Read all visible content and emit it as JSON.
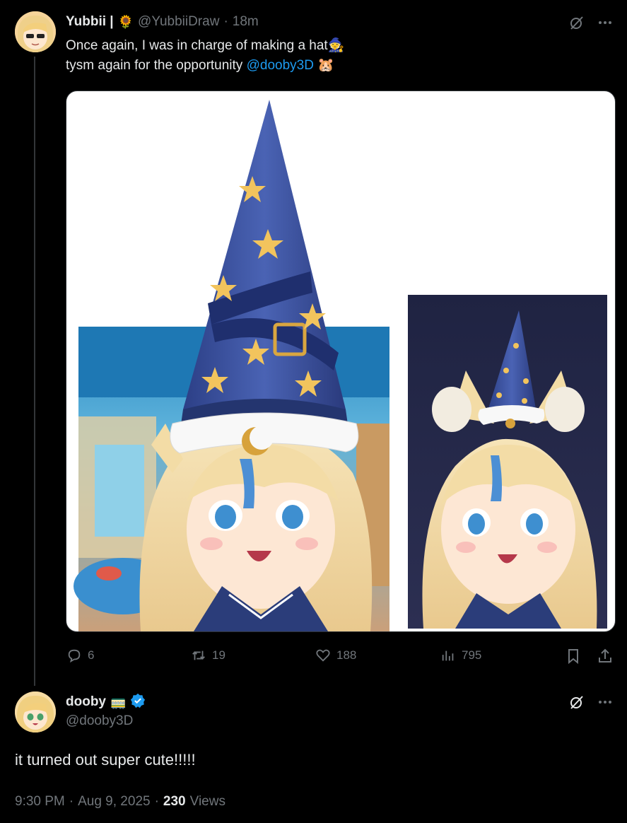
{
  "parent_tweet": {
    "display_name": "Yubbii |",
    "name_emoji": "🌻",
    "handle": "@YubbiiDraw",
    "separator": "·",
    "time": "18m",
    "line1": "Once again, I was in charge of making a hat",
    "line1_emoji": "🧙",
    "line2_prefix": "tysm again for the opportunity ",
    "mention": "@dooby3D",
    "line2_emoji": "🐹",
    "stats": {
      "replies": "6",
      "retweets": "19",
      "likes": "188",
      "views": "795"
    }
  },
  "reply_tweet": {
    "display_name": "dooby",
    "name_emoji": "🚃",
    "handle": "@dooby3D",
    "text": "it turned out super cute!!!!!",
    "time": "9:30 PM",
    "date": "Aug 9, 2025",
    "dot": "·",
    "views_count": "230",
    "views_label": "Views"
  },
  "icons": {
    "grok": "grok-icon",
    "more": "more-icon",
    "reply": "reply-icon",
    "retweet": "retweet-icon",
    "like": "heart-icon",
    "views": "views-icon",
    "bookmark": "bookmark-icon",
    "share": "share-icon",
    "verified": "verified-badge-icon"
  },
  "colors": {
    "background": "#000000",
    "text": "#e7e9ea",
    "muted": "#71767b",
    "accent": "#1d9bf0"
  }
}
